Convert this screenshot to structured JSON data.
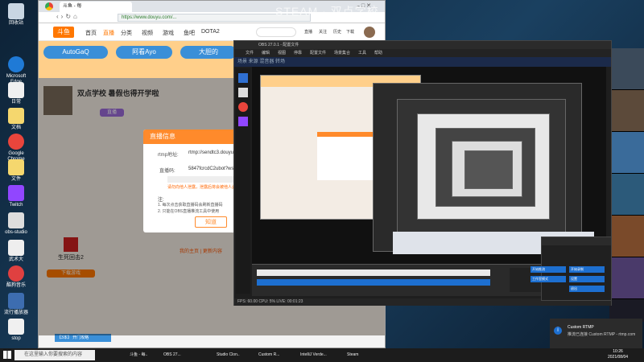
{
  "desktop": {
    "icons": [
      {
        "label": "回收站",
        "color": "#c9d6e3"
      },
      {
        "label": "Microsoft Edge",
        "color": "#1f7ad6"
      },
      {
        "label": "日常",
        "color": "#f0f0f0"
      },
      {
        "label": "文档",
        "color": "#f5d76e"
      },
      {
        "label": "Google Chrome",
        "color": "#e9453c"
      },
      {
        "label": "文件",
        "color": "#f5d76e"
      },
      {
        "label": "Twitch",
        "color": "#9146ff"
      },
      {
        "label": "obs-studio",
        "color": "#dddddd"
      },
      {
        "label": "武术大",
        "color": "#eeeeee"
      },
      {
        "label": "酷狗音乐",
        "color": "#e04040"
      },
      {
        "label": "流行播放器",
        "color": "#3d6db0"
      },
      {
        "label": "stop",
        "color": "#f0f0f0"
      }
    ]
  },
  "browser": {
    "tab_title": "斗鱼 - 每",
    "url": "https://www.douyu.com/...",
    "header": {
      "logo": "斗鱼",
      "nav": [
        "首页",
        "直播",
        "分类",
        "视频",
        "游戏",
        "鱼吧",
        "DOTA2"
      ],
      "right": [
        "直播",
        "关注",
        "历史",
        "下载"
      ]
    },
    "room": {
      "banner_left": "AutoGaQ",
      "banner_mid": "阿看Ayo",
      "banner_right": "大胆的",
      "title": "双点学校 暑假也得开学啦",
      "subtitle_btns": [
        "直播"
      ],
      "left_promo": "生死回击2",
      "left_promo_btn": "下载游戏",
      "bottom_ticker": "【3本】 开门攻略",
      "bottom_hint": "我的主页 | 更新内容"
    },
    "modal": {
      "title": "直播信息",
      "rtmp_label": "rtmp地址:",
      "rtmp_value": "rtmp://sendtc3.douyu.com/live",
      "code_label": "直播码:",
      "code_value": "5847fcrcdC2ubot?wsSecret=",
      "warn": "请勿向他人泄露，泄露后将会被他人盗用直播间",
      "note_title": "注:",
      "note1": "1. 每次点击获取直播码会刷新直播码",
      "note2": "2. 只能在OBS直播推流工具中使用",
      "confirm": "知道"
    }
  },
  "steam_overlay": "STEAM · 双点学校",
  "obs": {
    "title": "OBS 27.0.1 - 配置文件",
    "menu": [
      "文件",
      "编辑",
      "视图",
      "停靠",
      "配置文件",
      "场景集合",
      "工具",
      "帮助"
    ],
    "dock_title": "场景  来源  混音器  转场",
    "status": "FPS: 60.00  CPU: 5%  LIVE: 00:01:23",
    "buttons": [
      "开始推流",
      "开始录制",
      "工作室模式",
      "设置",
      "退出"
    ]
  },
  "notification": {
    "title": "Custom RTMP",
    "body": "推流已连接 Custom RTMP - rtmp.com"
  },
  "taskbar": {
    "search_placeholder": "在这里输入你要搜索的内容",
    "apps": [
      "斗鱼 - 每..",
      "OBS 27...",
      "Studio Clon..",
      "Custom R...",
      "IntelliJ Verde...",
      "Steam"
    ],
    "time": "10:26",
    "date": "2021/08/04"
  }
}
